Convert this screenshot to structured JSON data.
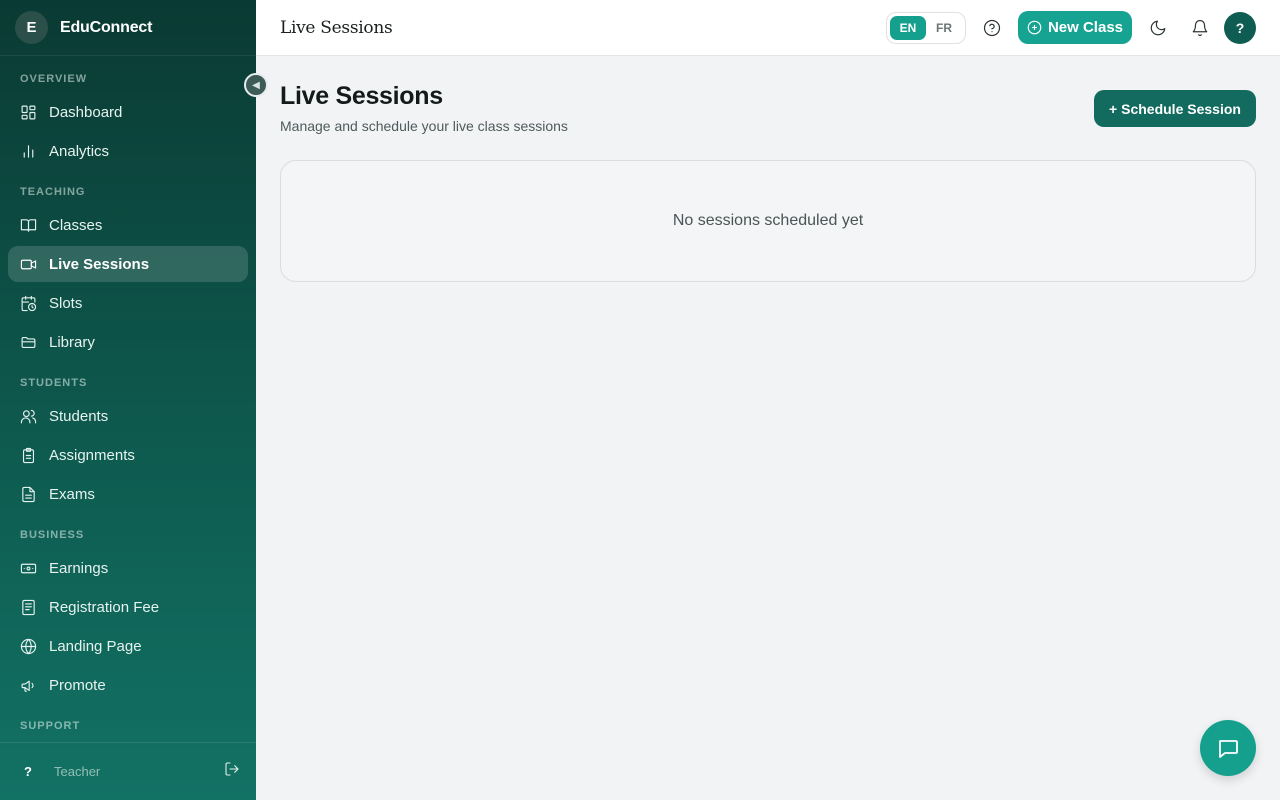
{
  "brand": {
    "initial": "E",
    "name": "EduConnect"
  },
  "sidebar": {
    "sections": {
      "overview": "OVERVIEW",
      "teaching": "TEACHING",
      "students": "STUDENTS",
      "business": "BUSINESS",
      "support": "SUPPORT"
    },
    "items": [
      {
        "label": "Dashboard",
        "icon": "dashboard-icon"
      },
      {
        "label": "Analytics",
        "icon": "analytics-icon"
      },
      {
        "label": "Classes",
        "icon": "book-icon"
      },
      {
        "label": "Live Sessions",
        "icon": "video-icon",
        "active": true
      },
      {
        "label": "Slots",
        "icon": "calendar-clock-icon"
      },
      {
        "label": "Library",
        "icon": "folder-icon"
      },
      {
        "label": "Students",
        "icon": "users-icon"
      },
      {
        "label": "Assignments",
        "icon": "clipboard-icon"
      },
      {
        "label": "Exams",
        "icon": "file-text-icon"
      },
      {
        "label": "Earnings",
        "icon": "banknote-icon"
      },
      {
        "label": "Registration Fee",
        "icon": "receipt-icon"
      },
      {
        "label": "Landing Page",
        "icon": "globe-icon"
      },
      {
        "label": "Promote",
        "icon": "megaphone-icon"
      }
    ],
    "footer": {
      "avatar": "?",
      "role": "Teacher"
    }
  },
  "header": {
    "title": "Live Sessions",
    "languages": [
      "EN",
      "FR"
    ],
    "active_language": "EN",
    "new_class_label": "New Class",
    "user_avatar": "?"
  },
  "main": {
    "title": "Live Sessions",
    "subtitle": "Manage and schedule your live class sessions",
    "schedule_button": "+ Schedule Session",
    "empty_state": "No sessions scheduled yet"
  },
  "colors": {
    "accent": "#14a08c",
    "sidebar_dark": "#0a3a33",
    "primary_button": "#136b5f"
  }
}
